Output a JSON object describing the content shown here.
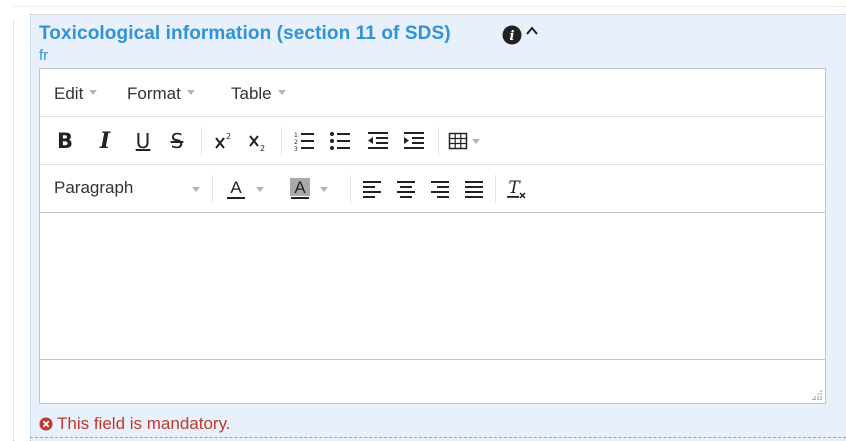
{
  "field": {
    "title": "Toxicological information (section 11 of SDS)",
    "language": "fr",
    "info_icon": "info-circle-icon",
    "collapse_icon": "chevron-up-icon"
  },
  "editor": {
    "menubar": {
      "edit_label": "Edit",
      "format_label": "Format",
      "table_label": "Table"
    },
    "toolbar": {
      "bold": "B",
      "italic": "I",
      "underline": "U",
      "strikethrough": "S",
      "block_format": "Paragraph"
    },
    "content": ""
  },
  "validation": {
    "message": "This field is mandatory."
  },
  "colors": {
    "title": "#2f93d6",
    "panel_bg": "#e7f0fb",
    "error": "#c0392b"
  }
}
